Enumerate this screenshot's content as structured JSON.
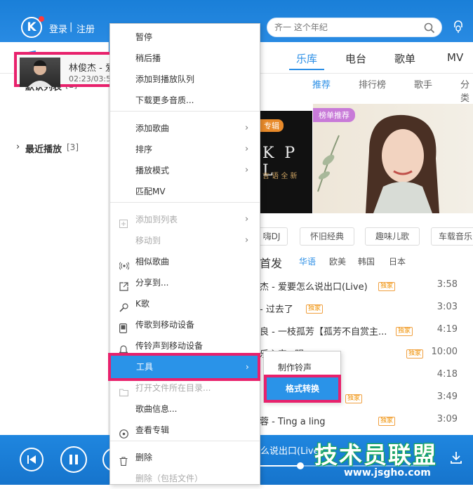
{
  "titlebar": {
    "logo": "K",
    "login": "登录",
    "divider": "|",
    "register": "注册",
    "search_placeholder": "齐一 这个年纪"
  },
  "left": {
    "default_list": "默认列表",
    "default_count": "[1]",
    "song_title": "林俊杰 - 爱",
    "song_time": "02:23/03:5",
    "recent": "最近播放",
    "recent_count": "[3]"
  },
  "main": {
    "tabs": [
      "乐库",
      "电台",
      "歌单",
      "MV"
    ],
    "subtabs": [
      "推荐",
      "排行榜",
      "歌手",
      "分类"
    ],
    "banner_tag_left": "专辑",
    "banner_tag": "榜单推荐",
    "banner_text": "K P L",
    "banner_sub": "言 语 全 新",
    "chips": [
      "嗨DJ",
      "怀旧经典",
      "趣味儿歌",
      "车载音乐"
    ],
    "section_title": "首发",
    "langs": [
      "华语",
      "欧美",
      "韩国",
      "日本"
    ],
    "songs": [
      {
        "title": "杰 - 爱要怎么说出口(Live)",
        "badge": "独家",
        "time": "3:58"
      },
      {
        "title": "- 过去了",
        "badge": "独家",
        "time": "3:03"
      },
      {
        "title": "良 - 一枝孤芳【孤芳不自赏主...",
        "badge": "独家",
        "time": "4:19"
      },
      {
        "title": "乐心安+明...",
        "badge": "独家",
        "time": "10:00"
      },
      {
        "title": "",
        "badge": "",
        "time": "4:18"
      },
      {
        "title": "",
        "badge": "独家",
        "time": "3:49"
      },
      {
        "title": "蓉 - Ting a ling",
        "badge": "独家",
        "time": "3:09"
      }
    ]
  },
  "bottom": {
    "now_playing": "么说出口(Live)"
  },
  "menu": {
    "items": [
      {
        "label": "暂停"
      },
      {
        "label": "稍后播"
      },
      {
        "label": "添加到播放队列"
      },
      {
        "label": "下载更多音质..."
      },
      {
        "label": "添加歌曲"
      },
      {
        "label": "排序"
      },
      {
        "label": "播放模式"
      },
      {
        "label": "匹配MV"
      },
      {
        "label": "添加到列表"
      },
      {
        "label": "移动到"
      },
      {
        "label": "相似歌曲"
      },
      {
        "label": "分享到..."
      },
      {
        "label": "K歌"
      },
      {
        "label": "传歌到移动设备"
      },
      {
        "label": "传铃声到移动设备"
      },
      {
        "label": "工具"
      },
      {
        "label": "打开文件所在目录..."
      },
      {
        "label": "歌曲信息..."
      },
      {
        "label": "查看专辑"
      },
      {
        "label": "删除"
      },
      {
        "label": "删除（包括文件）"
      }
    ],
    "submenu": {
      "ringtone": "制作铃声",
      "convert": "格式转换"
    }
  },
  "watermark": {
    "text": "技术员联盟",
    "url": "www.jsgho.com"
  },
  "colors": {
    "accent": "#2a93e8",
    "highlight": "#e8216c"
  }
}
